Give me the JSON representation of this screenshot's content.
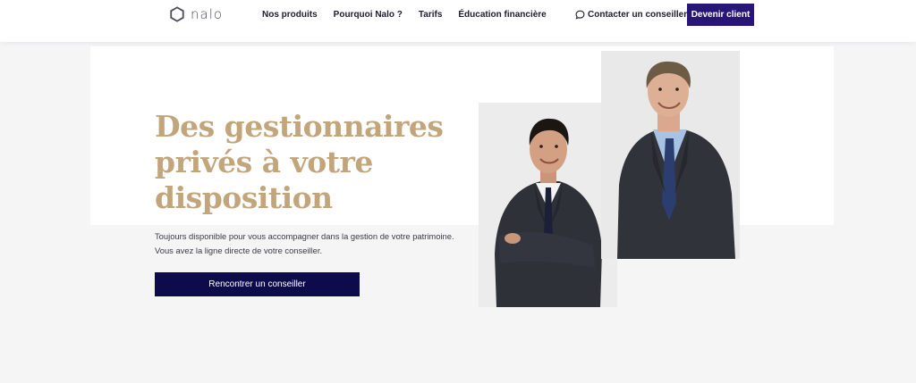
{
  "brand": {
    "name": "nalo",
    "logo_icon": "hexagon-logo-icon"
  },
  "nav": {
    "items": [
      {
        "label": "Nos produits"
      },
      {
        "label": "Pourquoi Nalo ?"
      },
      {
        "label": "Tarifs"
      },
      {
        "label": "Éducation financière"
      }
    ]
  },
  "header": {
    "contact_label": "Contacter un conseiller",
    "contact_icon": "chat-bubble-icon",
    "cta_label": "Devenir client"
  },
  "hero": {
    "headline_lines": [
      "Des gestionnaires",
      "privés à votre",
      "disposition"
    ],
    "subtext_lines": [
      "Toujours disponible pour vous accompagner dans la gestion de votre patrimoine.",
      "Vous avez la ligne directe de votre conseiller."
    ],
    "button_label": "Rencontrer un conseiller"
  },
  "colors": {
    "accent": "#271676",
    "button_dark": "#0e0b4c",
    "headline": "#c3a57c",
    "background": "#f5f5f6"
  }
}
